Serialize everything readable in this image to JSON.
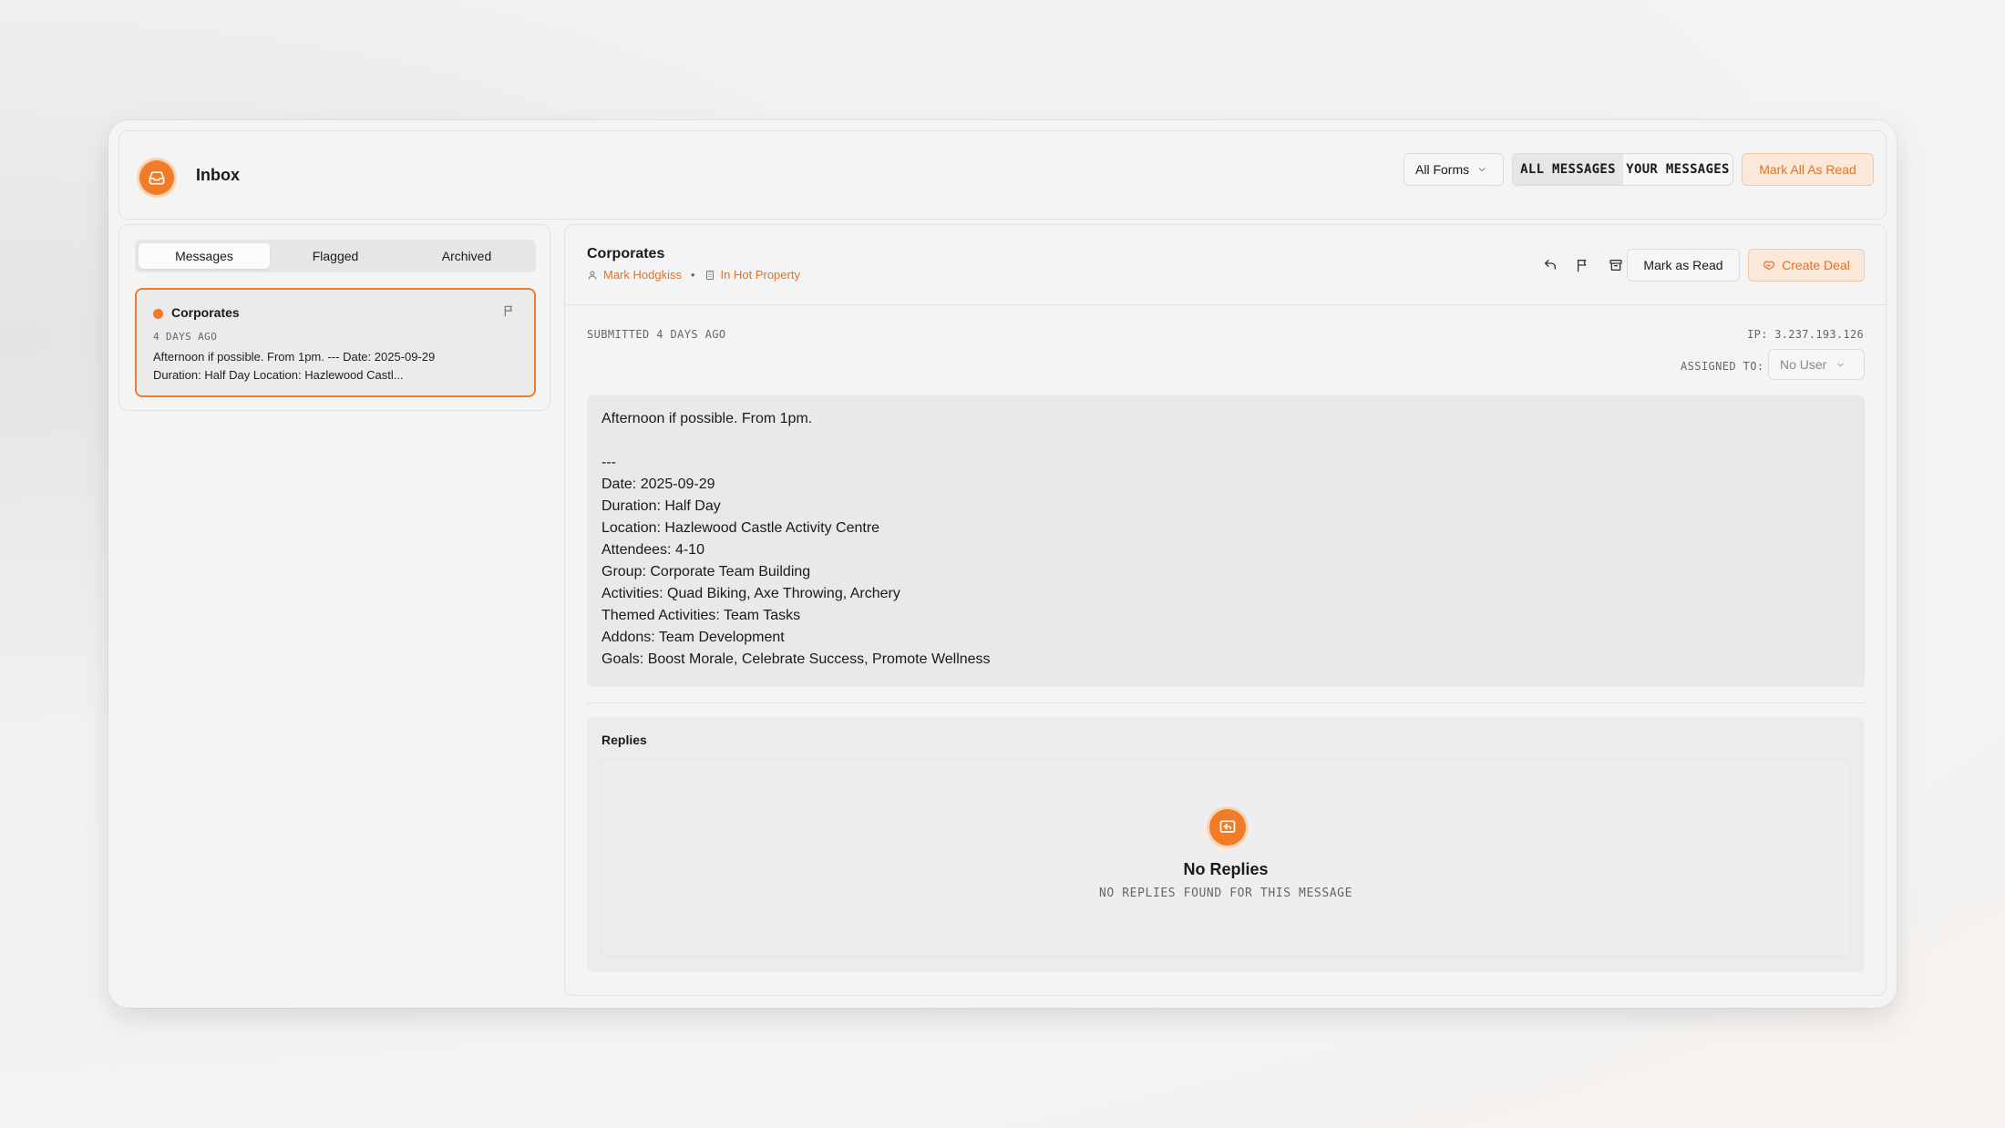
{
  "app": {
    "title": "Inbox"
  },
  "header": {
    "forms_filter": "All Forms",
    "scope_tabs": [
      "ALL MESSAGES",
      "YOUR MESSAGES"
    ],
    "mark_all_label": "Mark All As Read"
  },
  "sidebar": {
    "tabs": [
      "Messages",
      "Flagged",
      "Archived"
    ],
    "messages": [
      {
        "title": "Corporates",
        "date": "4 DAYS AGO",
        "preview_1": "Afternoon if possible. From 1pm. --- Date: 2025-09-29",
        "preview_2": "Duration: Half Day Location: Hazlewood Castl..."
      }
    ]
  },
  "detail": {
    "title": "Corporates",
    "contact": "Mark Hodgkiss",
    "company": "In Hot Property",
    "mark_read_label": "Mark as Read",
    "create_deal_label": "Create Deal",
    "submitted": "SUBMITTED 4 DAYS AGO",
    "ip": "IP: 3.237.193.126",
    "assigned_label": "ASSIGNED TO:",
    "assigned_value": "No User",
    "body_lines": [
      "Afternoon if possible. From 1pm.",
      "",
      "---",
      "Date: 2025-09-29",
      "Duration: Half Day",
      "Location: Hazlewood Castle Activity Centre",
      "Attendees: 4-10",
      "Group: Corporate Team Building",
      "Activities: Quad Biking, Axe Throwing, Archery",
      "Themed Activities: Team Tasks",
      "Addons: Team Development",
      "Goals: Boost Morale, Celebrate Success, Promote Wellness"
    ],
    "replies_title": "Replies",
    "empty_title": "No Replies",
    "empty_subtitle": "NO REPLIES FOUND FOR THIS MESSAGE"
  },
  "colors": {
    "accent": "#ef7c2c",
    "accent_soft": "#fbe8d8"
  },
  "icons": [
    "inbox-icon",
    "chevron-down-icon",
    "flag-icon",
    "reply-icon",
    "archive-icon",
    "user-icon",
    "building-icon",
    "handshake-icon",
    "reply-message-icon"
  ]
}
